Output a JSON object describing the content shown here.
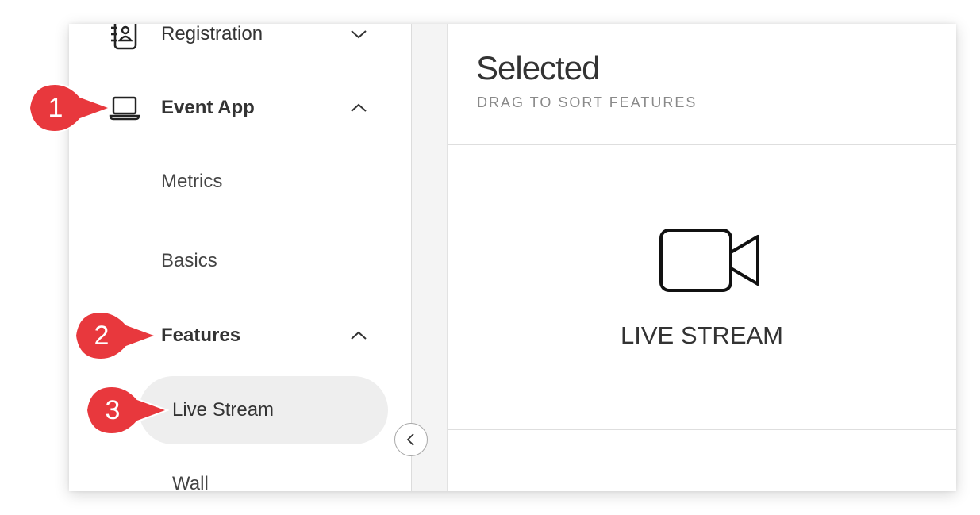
{
  "sidebar": {
    "items": [
      {
        "label": "Registration",
        "icon": "address-book-icon",
        "expanded": false
      },
      {
        "label": "Event App",
        "icon": "laptop-icon",
        "expanded": true
      }
    ],
    "event_app_children": [
      {
        "label": "Metrics"
      },
      {
        "label": "Basics"
      }
    ],
    "features": {
      "label": "Features",
      "expanded": true
    },
    "feature_children": [
      {
        "label": "Live Stream",
        "active": true
      },
      {
        "label": "Wall"
      }
    ]
  },
  "main": {
    "title": "Selected",
    "subtitle": "DRAG TO SORT FEATURES",
    "cards": [
      {
        "label": "LIVE STREAM",
        "icon": "video-camera-icon"
      }
    ]
  },
  "callouts": [
    {
      "number": "1"
    },
    {
      "number": "2"
    },
    {
      "number": "3"
    }
  ],
  "colors": {
    "callout": "#e8383d",
    "active_bg": "#eeeeee",
    "text": "#333333",
    "muted": "#8a8a8a"
  }
}
